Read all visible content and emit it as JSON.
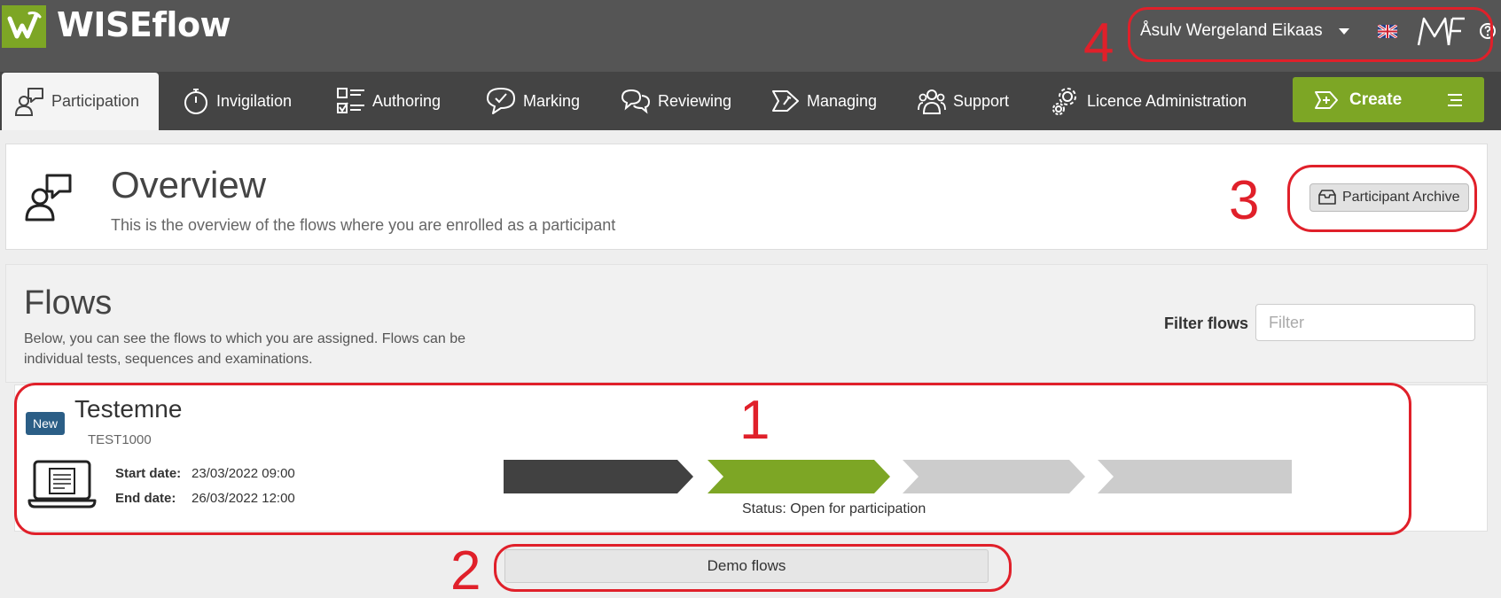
{
  "app": {
    "name": "WISEflow"
  },
  "user": {
    "name": "Åsulv Wergeland Eikaas",
    "initials": "MF"
  },
  "nav": {
    "items": [
      {
        "label": "Participation",
        "icon": "participant-icon",
        "active": true
      },
      {
        "label": "Invigilation",
        "icon": "stopwatch-icon"
      },
      {
        "label": "Authoring",
        "icon": "checklist-icon"
      },
      {
        "label": "Marking",
        "icon": "speech-check-icon"
      },
      {
        "label": "Reviewing",
        "icon": "speech-bubbles-icon"
      },
      {
        "label": "Managing",
        "icon": "tool-icon"
      },
      {
        "label": "Support",
        "icon": "people-icon"
      },
      {
        "label": "Licence Administration",
        "icon": "gears-icon"
      }
    ],
    "create_label": "Create"
  },
  "overview": {
    "title": "Overview",
    "subtitle": "This is the overview of the flows where you are enrolled as a participant",
    "archive_label": "Participant Archive"
  },
  "flows": {
    "title": "Flows",
    "description": "Below, you can see the flows to which you are assigned. Flows can be individual tests, sequences and examinations.",
    "filter_label": "Filter flows",
    "filter_placeholder": "Filter",
    "filter_value": ""
  },
  "flow": {
    "badge": "New",
    "name": "Testemne",
    "code": "TEST1000",
    "start_label": "Start date:",
    "start_value": "23/03/2022 09:00",
    "end_label": "End date:",
    "end_value": "26/03/2022 12:00",
    "status": "Status: Open for participation",
    "phases": [
      "completed",
      "current",
      "upcoming",
      "upcoming"
    ]
  },
  "demo": {
    "label": "Demo flows"
  },
  "annotations": [
    "1",
    "2",
    "3",
    "4"
  ],
  "colors": {
    "topbar": "#555555",
    "navbar": "#444444",
    "accent_green": "#7da625",
    "badge_blue": "#2b5e86",
    "phase_done": "#414141",
    "phase_current": "#7da625",
    "phase_upcoming": "#cccccc",
    "annotation_red": "#e0202a"
  }
}
